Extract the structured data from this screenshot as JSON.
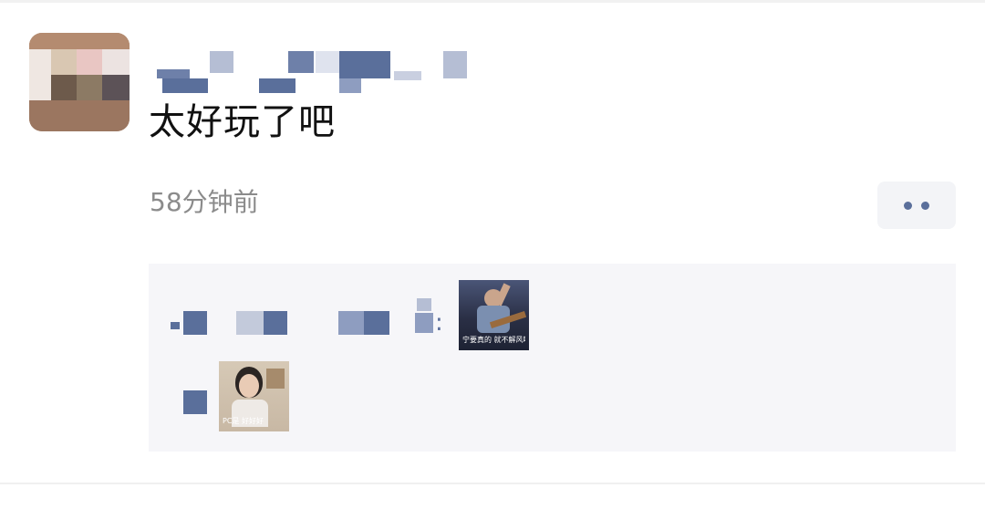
{
  "post": {
    "text": "太好玩了吧",
    "time": "58分钟前"
  },
  "more_button": {
    "icon": "more-dots-icon"
  },
  "comments": [
    {
      "separator": ":",
      "sticker": {
        "icon": "sticker-image",
        "caption": "宁要真的 就不解风味"
      }
    },
    {
      "separator": "",
      "sticker": {
        "icon": "sticker-image",
        "caption": "PC是 好好好"
      }
    }
  ],
  "colors": {
    "accent_blue": "#5a6f9b",
    "text_primary": "#111111",
    "text_secondary": "#8b8b8b",
    "panel_bg": "#f6f6f9"
  }
}
